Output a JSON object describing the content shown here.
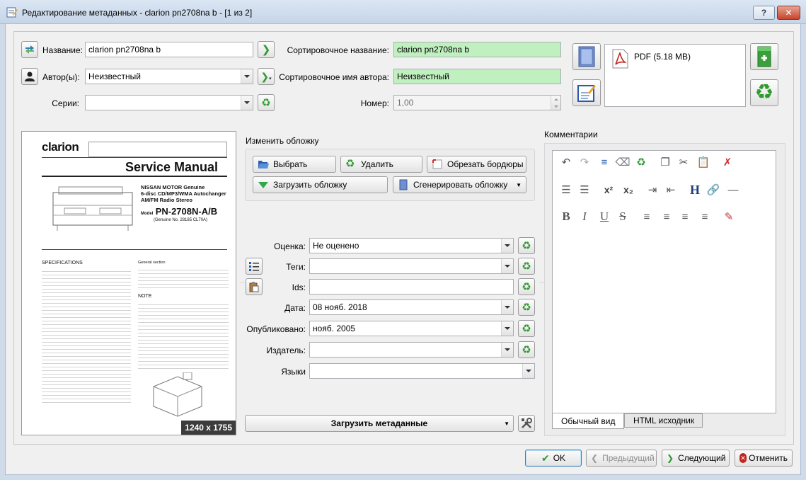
{
  "window": {
    "title": "Редактирование метаданных - clarion pn2708na b -  [1 из 2]",
    "help_label": "?",
    "close_label": "✕"
  },
  "basic": {
    "title_label": "Название:",
    "title_value": "clarion pn2708na b",
    "author_label": "Автор(ы):",
    "author_value": "Неизвестный",
    "series_label": "Серии:",
    "series_value": "",
    "sort_title_label": "Сортировочное название:",
    "sort_title_value": "clarion pn2708na b",
    "sort_author_label": "Сортировочное имя автора:",
    "sort_author_value": "Неизвестный",
    "number_label": "Номер:",
    "number_value": "1,00"
  },
  "formats": {
    "items": [
      "PDF (5.18 MB)"
    ]
  },
  "cover": {
    "section_label": "Изменить обложку",
    "dimensions": "1240 x 1755",
    "browse_label": "Выбрать",
    "remove_label": "Удалить",
    "trim_label": "Обрезать бордюры",
    "download_label": "Загрузить обложку",
    "generate_label": "Сгенерировать обложку",
    "doc_brand": "clarion",
    "doc_heading": "Service Manual",
    "doc_sub1": "NISSAN MOTOR  Genuine",
    "doc_sub2": "6-disc CD/MP3/WMA Autochanger",
    "doc_sub3": "AM/FM Radio Stereo",
    "doc_model_prefix": "Model",
    "doc_model": "PN-2708N-A/B",
    "doc_genuine": "(Genuine No. 28185 CL70A)",
    "doc_spec": "SPECIFICATIONS",
    "doc_general": "General section",
    "doc_note": "NOTE"
  },
  "fields": {
    "rating_label": "Оценка:",
    "rating_value": "Не оценено",
    "tags_label": "Теги:",
    "tags_value": "",
    "ids_label": "Ids:",
    "ids_value": "",
    "date_label": "Дата:",
    "date_value": "08 нояб. 2018",
    "published_label": "Опубликовано:",
    "published_value": "нояб. 2005",
    "publisher_label": "Издатель:",
    "publisher_value": "",
    "languages_label": "Языки",
    "languages_value": ""
  },
  "metadata_button": "Загрузить метаданные",
  "comments": {
    "label": "Комментарии",
    "tab_normal": "Обычный вид",
    "tab_html": "HTML исходник"
  },
  "footer": {
    "ok": "OK",
    "prev": "Предыдущий",
    "next": "Следующий",
    "cancel": "Отменить"
  },
  "colors": {
    "sort_field_bg": "#c1f0c0",
    "accent_green": "#2f9a2f"
  }
}
